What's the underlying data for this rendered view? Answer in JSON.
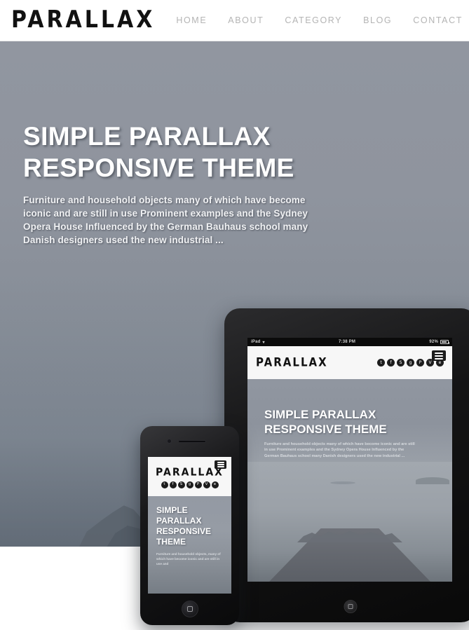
{
  "header": {
    "logo": "PARALLAX",
    "nav": [
      {
        "label": "HOME"
      },
      {
        "label": "ABOUT"
      },
      {
        "label": "CATEGORY"
      },
      {
        "label": "BLOG"
      },
      {
        "label": "CONTACT"
      }
    ]
  },
  "hero": {
    "title_line1": "SIMPLE PARALLAX",
    "title_line2": "RESPONSIVE THEME",
    "subtitle": "Furniture and household objects many of which have become iconic and are still in use Prominent examples and the Sydney Opera House Influenced by the German Bauhaus school  many Danish designers used the new industrial ...",
    "background_color": "#8d939d"
  },
  "tablet": {
    "status_bar": {
      "device": "iPad",
      "wifi_icon": "wifi-icon",
      "time": "7:38 PM",
      "battery_percent": "92%",
      "battery_icon": "battery-icon"
    },
    "logo": "PARALLAX",
    "menu_icon": "hamburger-menu-icon",
    "social": [
      {
        "name": "twitter-icon",
        "glyph": "t"
      },
      {
        "name": "facebook-icon",
        "glyph": "f"
      },
      {
        "name": "dribbble-icon",
        "glyph": "S"
      },
      {
        "name": "google-plus-icon",
        "glyph": "g"
      },
      {
        "name": "pinterest-icon",
        "glyph": "P"
      },
      {
        "name": "vimeo-icon",
        "glyph": "V"
      },
      {
        "name": "email-icon",
        "glyph": "e"
      }
    ],
    "title_line1": "SIMPLE PARALLAX",
    "title_line2": "RESPONSIVE THEME",
    "subtitle": "Furniture and household objects many of which have become iconic and are still in use Prominent examples and the Sydney Opera House Influenced by the German Bauhaus school  many Danish designers used the new industrial ...",
    "home_button": "home-button"
  },
  "phone": {
    "logo": "PARALLAX",
    "menu_icon": "hamburger-menu-icon",
    "social": [
      {
        "name": "twitter-icon",
        "glyph": "t"
      },
      {
        "name": "facebook-icon",
        "glyph": "f"
      },
      {
        "name": "dribbble-icon",
        "glyph": "S"
      },
      {
        "name": "google-plus-icon",
        "glyph": "g"
      },
      {
        "name": "pinterest-icon",
        "glyph": "P"
      },
      {
        "name": "vimeo-icon",
        "glyph": "V"
      },
      {
        "name": "email-icon",
        "glyph": "e"
      }
    ],
    "title_line1": "SIMPLE",
    "title_line2": "PARALLAX",
    "title_line3": "RESPONSIVE",
    "title_line4": "THEME",
    "subtitle": "Furniture and household objects, many of which have become iconic and are still in use and",
    "home_button": "home-button"
  }
}
